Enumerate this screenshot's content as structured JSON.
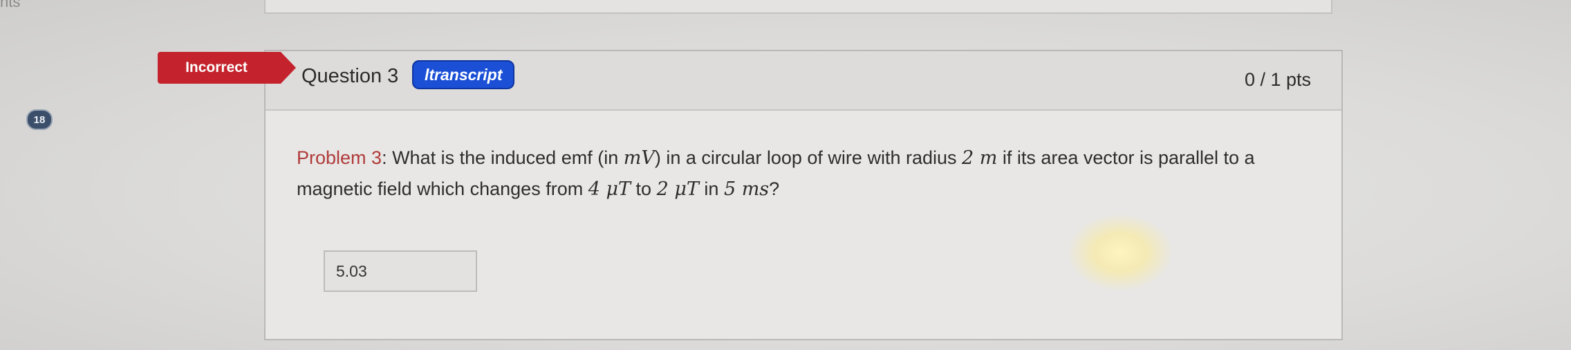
{
  "corner": {
    "text": "nts"
  },
  "question_number_badge": "18",
  "status_tag": {
    "label": "Incorrect"
  },
  "question": {
    "title": "Question 3",
    "transcript_label": "ltranscript",
    "points": "0 / 1 pts"
  },
  "problem": {
    "label": "Problem 3",
    "t1": ": What is the induced emf (in ",
    "m1": "mV",
    "t2": ") in a circular loop of wire with radius ",
    "m2": "2 m",
    "t3": " if its area vector is parallel to a magnetic field which changes from ",
    "m3": "4 μT",
    "t4": " to ",
    "m4": "2 μT",
    "t5": " in ",
    "m5": "5 ms",
    "t6": "?"
  },
  "answer": {
    "value": "5.03"
  },
  "colors": {
    "incorrect": "#c4232d",
    "transcript": "#1a4fd6",
    "badge": "#3b4f6b"
  }
}
